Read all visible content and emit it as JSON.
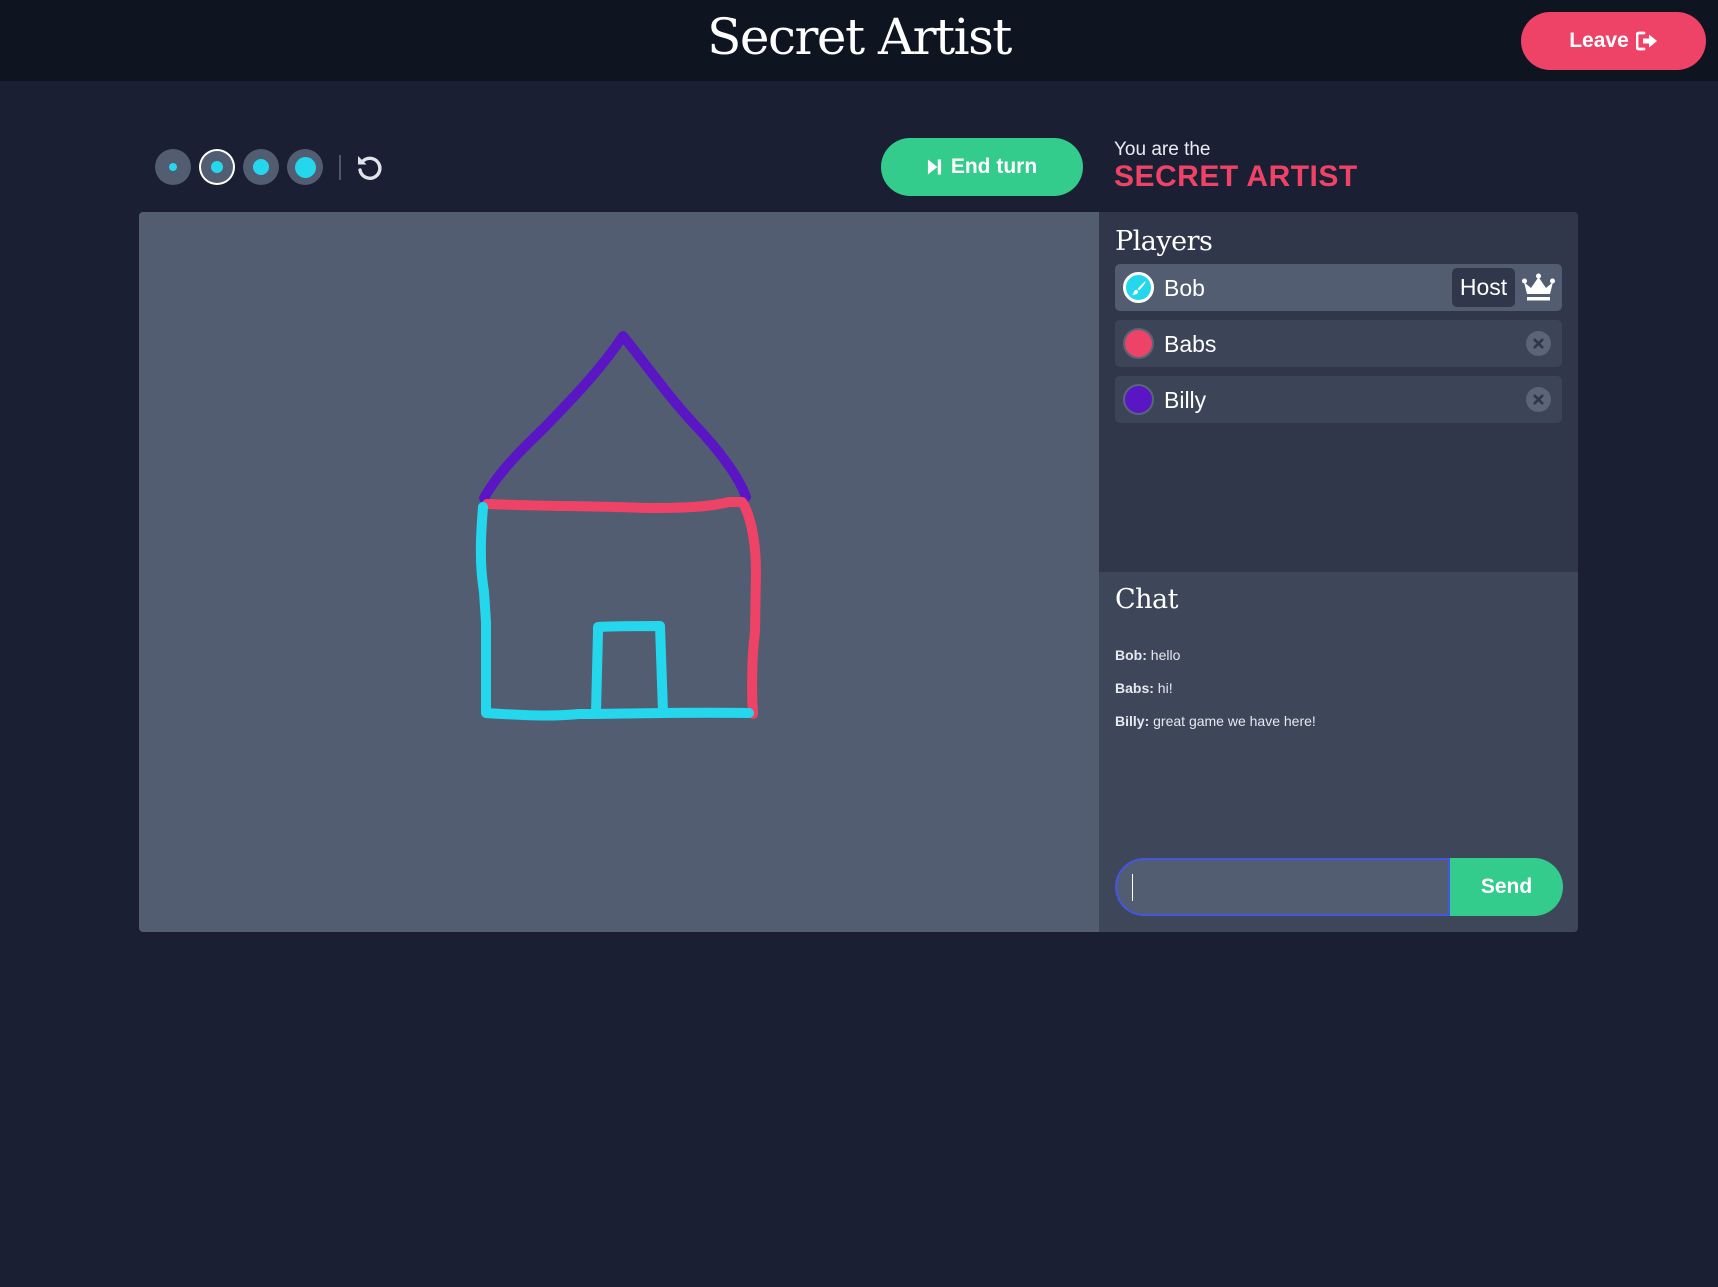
{
  "header": {
    "title": "Secret Artist",
    "leave_label": "Leave",
    "leave_icon": "sign-out-icon"
  },
  "toolbar": {
    "brush_sizes": [
      {
        "name": "extra-small",
        "selected": false
      },
      {
        "name": "small",
        "selected": true
      },
      {
        "name": "medium",
        "selected": false
      },
      {
        "name": "large",
        "selected": false
      }
    ],
    "brush_color": "#24d7ed",
    "undo_icon": "undo-icon",
    "end_turn_label": "End turn",
    "end_turn_icon": "step-forward-icon"
  },
  "role": {
    "prefix": "You are the",
    "name": "SECRET ARTIST",
    "color": "#ee4266"
  },
  "drawing": {
    "strokes": [
      {
        "color": "#5a16c4",
        "label": "roof"
      },
      {
        "color": "#ee4266",
        "label": "ceiling-and-right-wall"
      },
      {
        "color": "#24d7ed",
        "label": "left-wall-floor-and-door"
      }
    ]
  },
  "players": {
    "heading": "Players",
    "list": [
      {
        "name": "Bob",
        "color": "#24d7ed",
        "is_drawing": true,
        "badge": "Host",
        "is_host": true
      },
      {
        "name": "Babs",
        "color": "#ee4266",
        "is_drawing": false,
        "can_kick": true
      },
      {
        "name": "Billy",
        "color": "#5a16c4",
        "is_drawing": false,
        "can_kick": true
      }
    ]
  },
  "chat": {
    "heading": "Chat",
    "messages": [
      {
        "author": "Bob",
        "text": "hello"
      },
      {
        "author": "Babs",
        "text": "hi!"
      },
      {
        "author": "Billy",
        "text": "great game we have here!"
      }
    ],
    "input_value": "",
    "input_placeholder": "",
    "send_label": "Send"
  },
  "colors": {
    "accent_red": "#ee4266",
    "accent_green": "#33cc8d",
    "cyan": "#24d7ed",
    "purple": "#5a16c4",
    "background": "#1a1f33",
    "header": "#0f1421"
  }
}
